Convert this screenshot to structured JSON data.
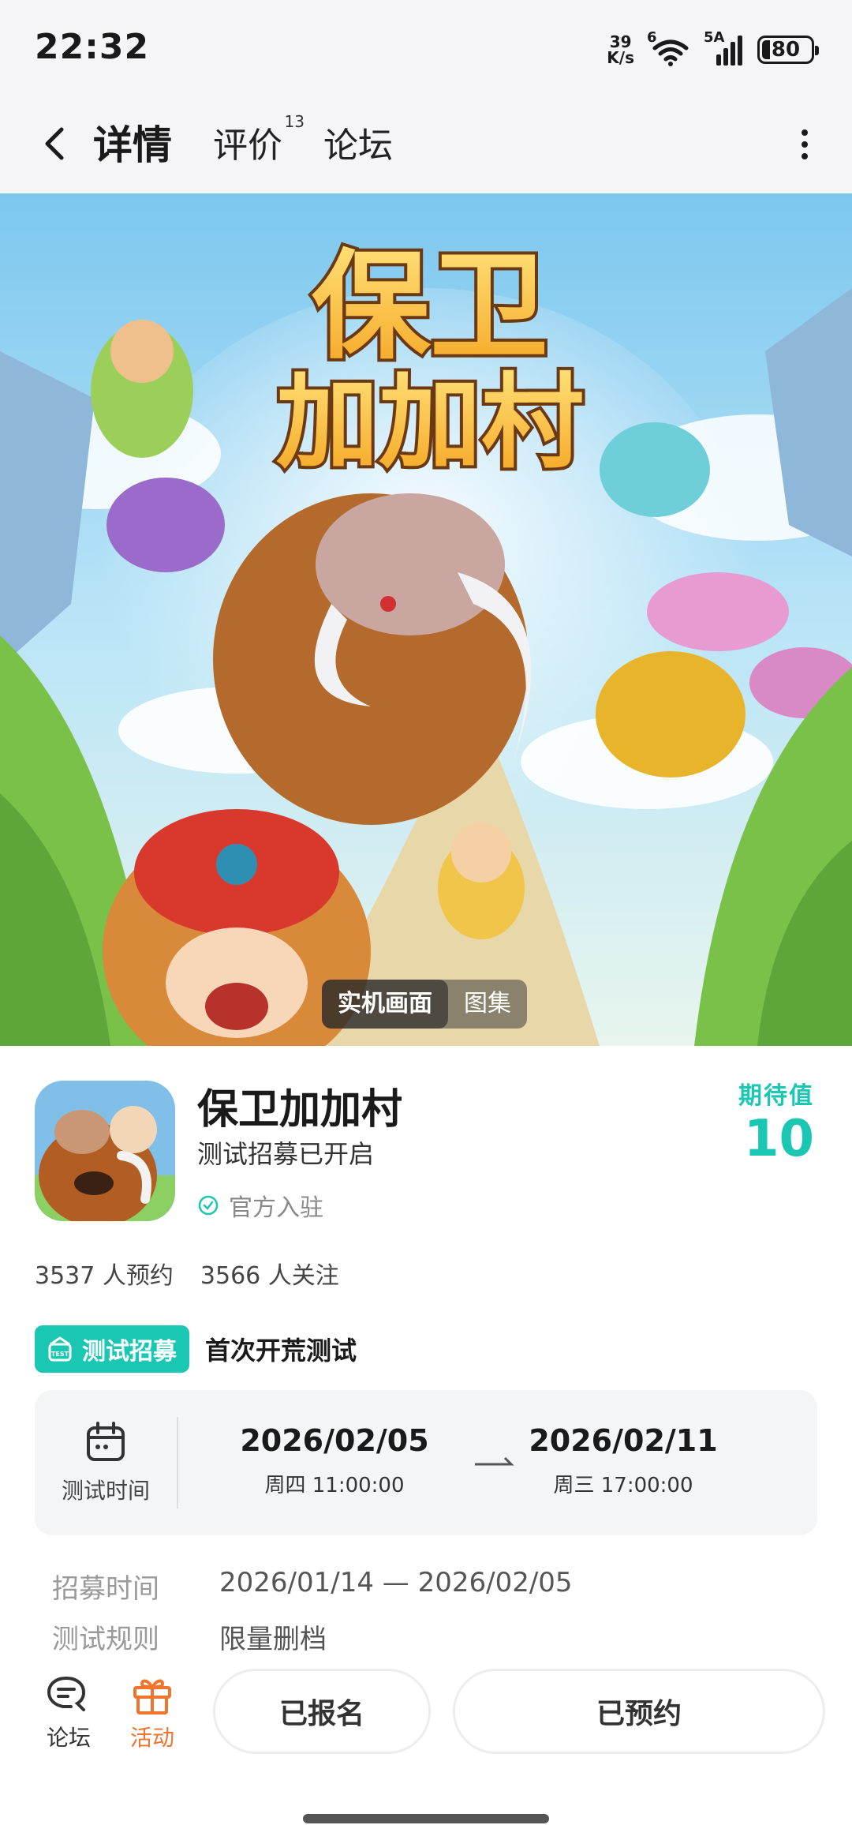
{
  "status_bar": {
    "time": "22:32",
    "net_speed_value": "39",
    "net_speed_unit": "K/s",
    "wifi_tag": "6",
    "signal_tag": "5A",
    "battery": "80",
    "battery_level": 0.8
  },
  "header": {
    "tabs": [
      {
        "label": "详情",
        "active": true
      },
      {
        "label": "评价",
        "badge": "13"
      },
      {
        "label": "论坛"
      }
    ]
  },
  "banner": {
    "logo_line1": "保卫",
    "logo_line2": "加加村",
    "options": [
      "实机画面",
      "图集"
    ],
    "active_option": "实机画面"
  },
  "game": {
    "title": "保卫加加村",
    "subtitle": "测试招募已开启",
    "official": "官方入驻",
    "expect_label": "期待值",
    "expect_value": "10",
    "reservations": "3537 人预约",
    "followers": "3566 人关注"
  },
  "recruit": {
    "badge": "测试招募",
    "name": "首次开荒测试",
    "test_time_label": "测试时间",
    "start_date": "2026/02/05",
    "start_time": "周四  11:00:00",
    "end_date": "2026/02/11",
    "end_time": "周三  17:00:00",
    "meta": [
      {
        "key": "招募时间",
        "value": "2026/01/14 — 2026/02/05"
      },
      {
        "key": "测试规则",
        "value": "限量删档"
      }
    ]
  },
  "actions": {
    "forum": "论坛",
    "activity": "活动",
    "signed_up": "已报名",
    "reserved": "已预约"
  },
  "colors": {
    "accent": "#19c7b3",
    "activity": "#f0742e"
  }
}
